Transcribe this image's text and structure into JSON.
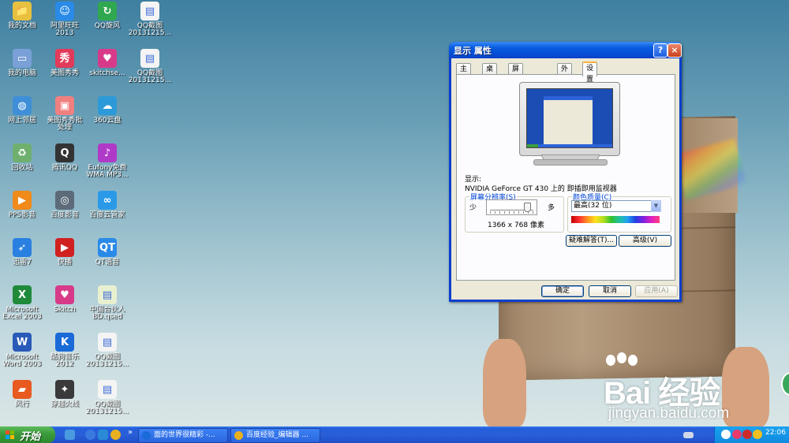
{
  "desktop": {
    "icons": [
      {
        "label": "我的文档",
        "icon": "my-documents-icon",
        "color": "#e8c040",
        "glyph": "📁"
      },
      {
        "label": "阿里旺旺\n2013",
        "icon": "aliwangwang-icon",
        "color": "#2a8ae8",
        "glyph": "☺"
      },
      {
        "label": "QQ旋风",
        "icon": "qq-whirlwind-icon",
        "color": "#2fa84f",
        "glyph": "↻"
      },
      {
        "label": "QQ截图\n20131215...",
        "icon": "image-file-icon",
        "color": "#f4f4f4",
        "glyph": "▤"
      },
      {
        "label": "我的电脑",
        "icon": "my-computer-icon",
        "color": "#7aa0d8",
        "glyph": "▭"
      },
      {
        "label": "美图秀秀",
        "icon": "meitu-icon",
        "color": "#e23a5a",
        "glyph": "秀"
      },
      {
        "label": "skitchse...",
        "icon": "skitch-icon",
        "color": "#d83a8a",
        "glyph": "♥"
      },
      {
        "label": "QQ截图\n20131215...",
        "icon": "image-file-icon",
        "color": "#f4f4f4",
        "glyph": "▤"
      },
      {
        "label": "网上邻居",
        "icon": "network-places-icon",
        "color": "#3f8fd8",
        "glyph": "◍"
      },
      {
        "label": "美图秀秀批\n处理",
        "icon": "meitu-batch-icon",
        "color": "#f08080",
        "glyph": "▣"
      },
      {
        "label": "360云盘",
        "icon": "360-cloud-icon",
        "color": "#2c9ad8",
        "glyph": "☁"
      },
      {
        "label": "回收站",
        "icon": "recycle-bin-icon",
        "color": "#6fb06f",
        "glyph": "♻"
      },
      {
        "label": "腾讯QQ",
        "icon": "tencent-qq-icon",
        "color": "#333333",
        "glyph": "Q"
      },
      {
        "label": "Eufony免费\nWMA MP3...",
        "icon": "eufony-icon",
        "color": "#b03ac8",
        "glyph": "♪"
      },
      {
        "label": "PPS影音",
        "icon": "pps-icon",
        "color": "#f08a1a",
        "glyph": "▶"
      },
      {
        "label": "百度影音",
        "icon": "baidu-video-icon",
        "color": "#5c6a7a",
        "glyph": "◎"
      },
      {
        "label": "百度云管家",
        "icon": "baidu-cloud-icon",
        "color": "#2a9ae8",
        "glyph": "∞"
      },
      {
        "label": "迅雷7",
        "icon": "thunder-icon",
        "color": "#2a80e0",
        "glyph": "➶"
      },
      {
        "label": "快播",
        "icon": "qvod-icon",
        "color": "#d02020",
        "glyph": "▶"
      },
      {
        "label": "QT语音",
        "icon": "qt-voice-icon",
        "color": "#2a8ae8",
        "glyph": "QT"
      },
      {
        "label": "Microsoft\nExcel 2003",
        "icon": "excel-icon",
        "color": "#1f8a3a",
        "glyph": "X"
      },
      {
        "label": "Skitch",
        "icon": "skitch-app-icon",
        "color": "#d83a8a",
        "glyph": "♥"
      },
      {
        "label": "中国合伙人\nBD.qsed",
        "icon": "qsed-file-icon",
        "color": "#e8f0d0",
        "glyph": "▤"
      },
      {
        "label": "Microsoft\nWord 2003",
        "icon": "word-icon",
        "color": "#2a5ab8",
        "glyph": "W"
      },
      {
        "label": "酷狗音乐\n2012",
        "icon": "kugou-icon",
        "color": "#1a6ad8",
        "glyph": "K"
      },
      {
        "label": "QQ截图\n20131215...",
        "icon": "image-file-icon",
        "color": "#f4f4f4",
        "glyph": "▤"
      },
      {
        "label": "风行",
        "icon": "funshion-icon",
        "color": "#e85a20",
        "glyph": "▰"
      },
      {
        "label": "穿越火线",
        "icon": "crossfire-icon",
        "color": "#3a3a3a",
        "glyph": "✦"
      },
      {
        "label": "QQ截图\n20131215...",
        "icon": "image-file-icon",
        "color": "#f4f4f4",
        "glyph": "▤"
      }
    ]
  },
  "watermark": {
    "main": "Bai 经验",
    "sub": "jingyan.baidu.com"
  },
  "dialog": {
    "title": "显示 属性",
    "help_label": "?",
    "close_label": "×",
    "tabs": [
      "主题",
      "桌面",
      "屏幕保护程序",
      "外观",
      "设置"
    ],
    "active_tab": 4,
    "display_label": "显示:",
    "display_value": "NVIDIA GeForce GT 430 上的 即插即用监视器",
    "resolution": {
      "title": "屏幕分辨率(S)",
      "less": "少",
      "more": "多",
      "value_text": "1366 x 768 像素",
      "slider_level": 0.85
    },
    "color": {
      "title": "颜色质量(C)",
      "selected": "最高(32 位)",
      "bar_colors": [
        "#c00000",
        "#ff3030",
        "#ff9020",
        "#ffe020",
        "#b0e020",
        "#30c030",
        "#20c0a0",
        "#20a0f0",
        "#2040e0",
        "#8020e0",
        "#e020c0",
        "#ff4080"
      ]
    },
    "troubleshoot_label": "疑难解答(T)...",
    "advanced_label": "高级(V)",
    "ok_label": "确定",
    "cancel_label": "取消",
    "apply_label": "应用(A)"
  },
  "taskbar": {
    "start_label": "开始",
    "quick_launch_more": "»",
    "tasks": [
      {
        "label": "面的世界很精彩 -...",
        "icon": "kugou-task-icon",
        "color": "#1a6ad8"
      },
      {
        "label": "百度经验_编辑器 ...",
        "icon": "chrome-task-icon",
        "color": "#e8b020"
      }
    ],
    "clock": "22:06"
  }
}
